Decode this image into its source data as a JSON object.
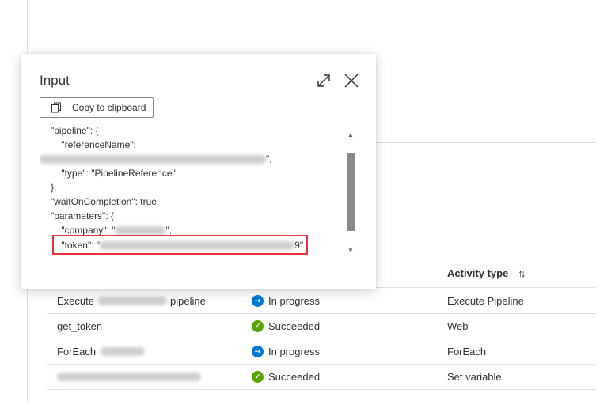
{
  "dialog": {
    "title": "Input",
    "copy_label": "Copy to clipboard",
    "code_lines": [
      "\"pipeline\": {",
      "    \"referenceName\":",
      "\",",
      "    \"type\": \"PipelineReference\"",
      "},",
      "\"waitOnCompletion\": true,",
      "\"parameters\": {",
      "    \"company\": \"",
      "\",",
      "    \"token\": \"",
      "9\""
    ]
  },
  "table": {
    "header_activity_type": "Activity type",
    "rows": [
      {
        "name_prefix": "Execute",
        "name_suffix": "pipeline",
        "status": "In progress",
        "status_kind": "in-progress",
        "type": "Execute Pipeline"
      },
      {
        "name_prefix": "get_token",
        "name_suffix": "",
        "status": "Succeeded",
        "status_kind": "succeeded",
        "type": "Web"
      },
      {
        "name_prefix": "ForEach",
        "name_suffix": "",
        "status": "In progress",
        "status_kind": "in-progress",
        "type": "ForEach"
      },
      {
        "name_prefix": "",
        "name_suffix": "",
        "status": "Succeeded",
        "status_kind": "succeeded",
        "type": "Set variable"
      }
    ]
  },
  "colors": {
    "in_progress": "#0078d4",
    "succeeded": "#57a300",
    "highlight": "#e8313a"
  }
}
